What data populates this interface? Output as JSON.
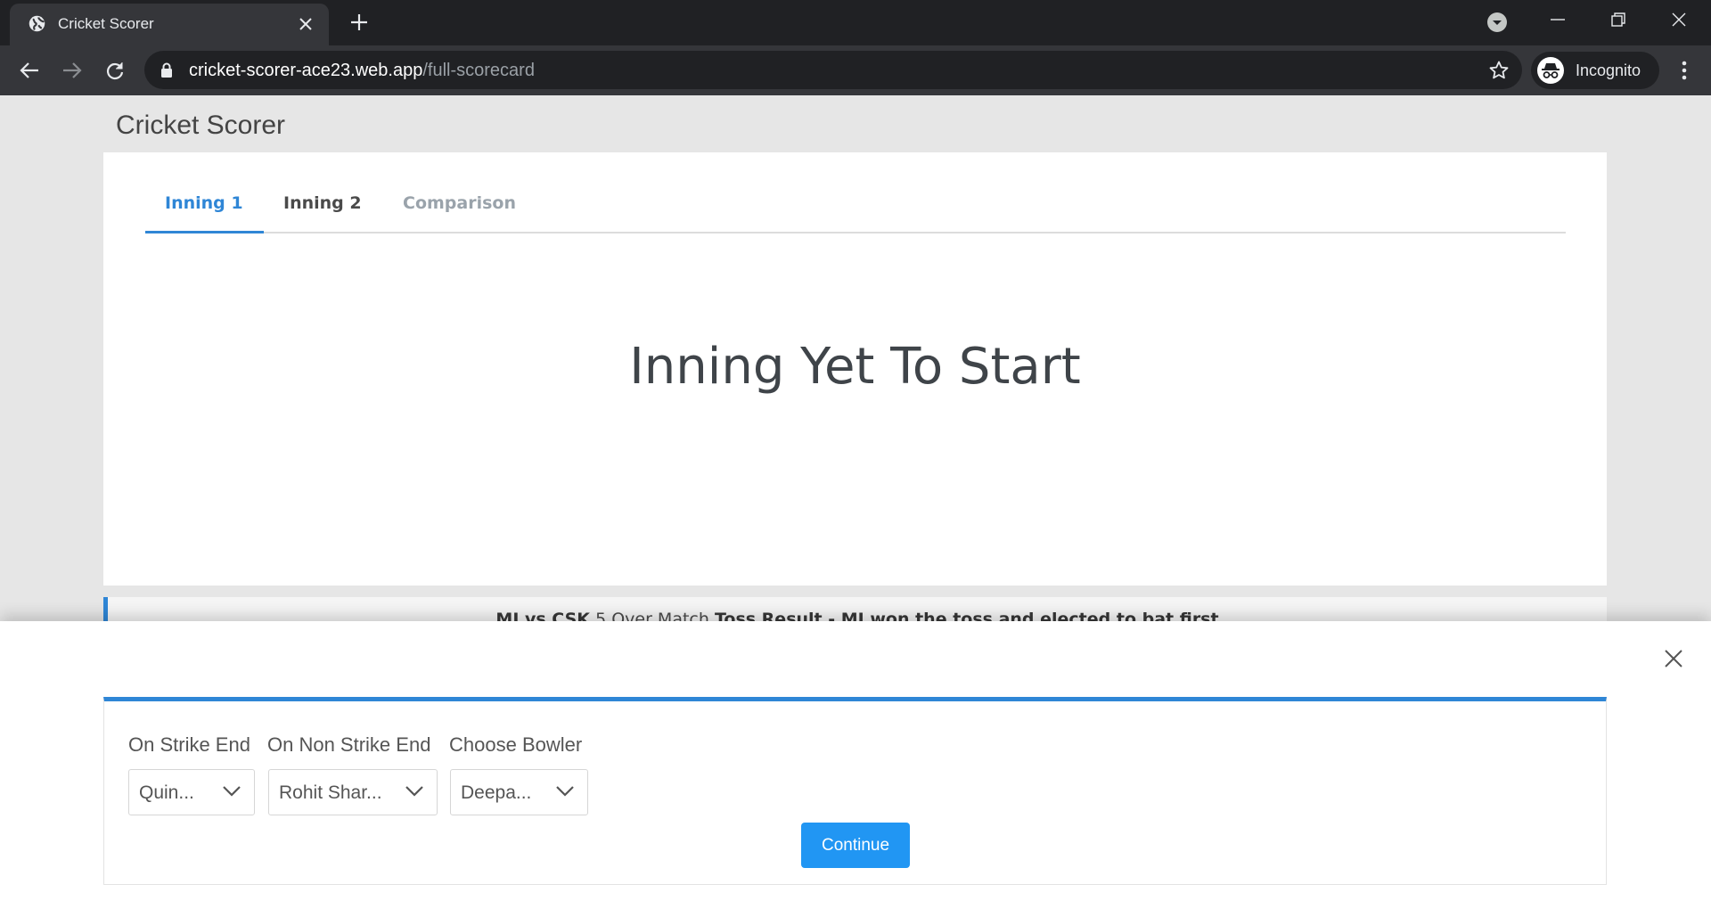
{
  "browser": {
    "tab_title": "Cricket Scorer",
    "url_host": "cricket-scorer-ace23.web.app",
    "url_path": "/full-scorecard",
    "profile_label": "Incognito"
  },
  "app": {
    "title": "Cricket Scorer"
  },
  "tabs": [
    {
      "label": "Inning 1",
      "active": true
    },
    {
      "label": "Inning 2",
      "active": false
    },
    {
      "label": "Comparison",
      "active": false
    }
  ],
  "main": {
    "empty_message": "Inning Yet To Start"
  },
  "match_info": {
    "teams": "MI vs CSK",
    "format": "5 Over Match",
    "toss_label": "Toss Result",
    "toss_text": "MI won the toss and elected to bat first"
  },
  "setup": {
    "on_strike": {
      "label": "On Strike End",
      "value": "Quin..."
    },
    "non_strike": {
      "label": "On Non Strike End",
      "value": "Rohit Shar..."
    },
    "bowler": {
      "label": "Choose Bowler",
      "value": "Deepa..."
    },
    "continue_label": "Continue"
  },
  "colors": {
    "accent": "#2f86d6",
    "button": "#2196f3",
    "page_bg": "#e6e6e6"
  }
}
